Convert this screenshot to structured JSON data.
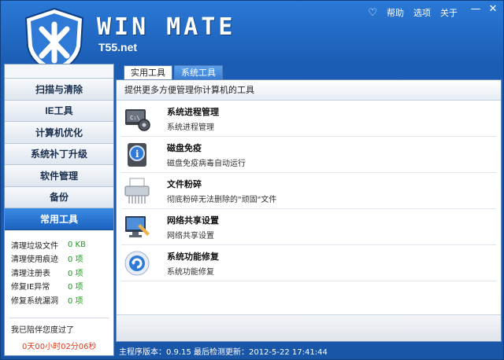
{
  "header": {
    "app_title": "WIN MATE",
    "app_site": "T55.net",
    "menu": {
      "help": "帮助",
      "options": "选项",
      "about": "关于"
    },
    "window_controls": {
      "minimize": "—",
      "close": "✕"
    }
  },
  "sidebar": {
    "items": [
      {
        "label": "扫描与清除"
      },
      {
        "label": "IE工具"
      },
      {
        "label": "计算机优化"
      },
      {
        "label": "系统补丁升级"
      },
      {
        "label": "软件管理"
      },
      {
        "label": "备份"
      },
      {
        "label": "常用工具",
        "active": true
      }
    ],
    "stats": [
      {
        "label": "清理垃圾文件",
        "value": "0 KB"
      },
      {
        "label": "清理使用痕迹",
        "value": "0 项"
      },
      {
        "label": "清理注册表",
        "value": "0 项"
      },
      {
        "label": "修复IE异常",
        "value": "0 项"
      },
      {
        "label": "修复系统漏洞",
        "value": "0 项"
      }
    ],
    "with_you": "我已陪伴您度过了",
    "time_used": "0天00小时02分06秒"
  },
  "content": {
    "tabs": [
      {
        "label": "实用工具",
        "active": true
      },
      {
        "label": "系统工具",
        "active": false
      }
    ],
    "panel_description": "提供更多方便管理你计算机的工具",
    "tools": [
      {
        "title": "系统进程管理",
        "desc": "系统进程管理",
        "icon": "process-manager-icon"
      },
      {
        "title": "磁盘免疫",
        "desc": "磁盘免疫病毒自动运行",
        "icon": "disk-immune-icon"
      },
      {
        "title": "文件粉碎",
        "desc": "彻底粉碎无法删除的\"顽固\"文件",
        "icon": "file-shredder-icon"
      },
      {
        "title": "网络共享设置",
        "desc": "网络共享设置",
        "icon": "network-share-icon"
      },
      {
        "title": "系统功能修复",
        "desc": "系统功能修复",
        "icon": "system-repair-icon"
      }
    ]
  },
  "status": {
    "text": "主程序版本：0.9.15   最后检测更新：2012-5-22 17:41:44"
  },
  "colors": {
    "accent": "#1c62c0",
    "stat_value": "#1a9b1a",
    "time_text": "#e03a1a"
  }
}
